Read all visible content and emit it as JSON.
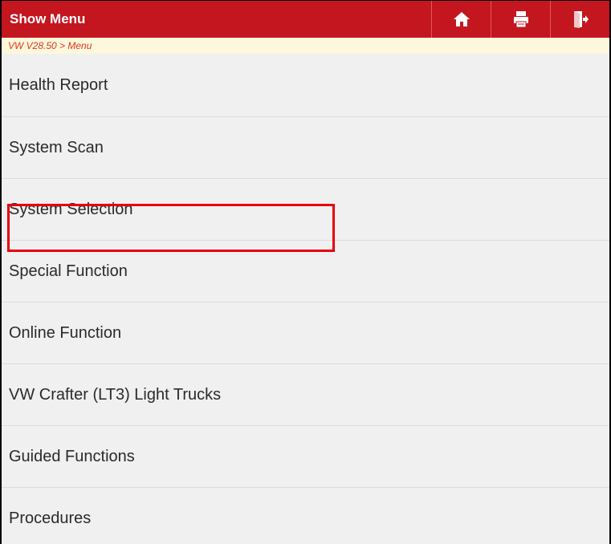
{
  "header": {
    "title": "Show Menu",
    "buttons": [
      {
        "icon": "home-icon"
      },
      {
        "icon": "print-icon"
      },
      {
        "icon": "exit-icon"
      }
    ]
  },
  "breadcrumb": "VW V28.50 > Menu",
  "menu": {
    "items": [
      {
        "label": "Health Report"
      },
      {
        "label": "System Scan"
      },
      {
        "label": "System Selection",
        "highlighted": true
      },
      {
        "label": "Special Function"
      },
      {
        "label": "Online Function"
      },
      {
        "label": "VW Crafter (LT3) Light Trucks"
      },
      {
        "label": "Guided Functions"
      },
      {
        "label": "Procedures"
      }
    ]
  },
  "colors": {
    "header_bg": "#c3161f",
    "breadcrumb_bg": "#fdf7dc",
    "breadcrumb_text": "#d9381e",
    "highlight_box": "#e8000d",
    "list_bg": "#f0f0f0"
  }
}
